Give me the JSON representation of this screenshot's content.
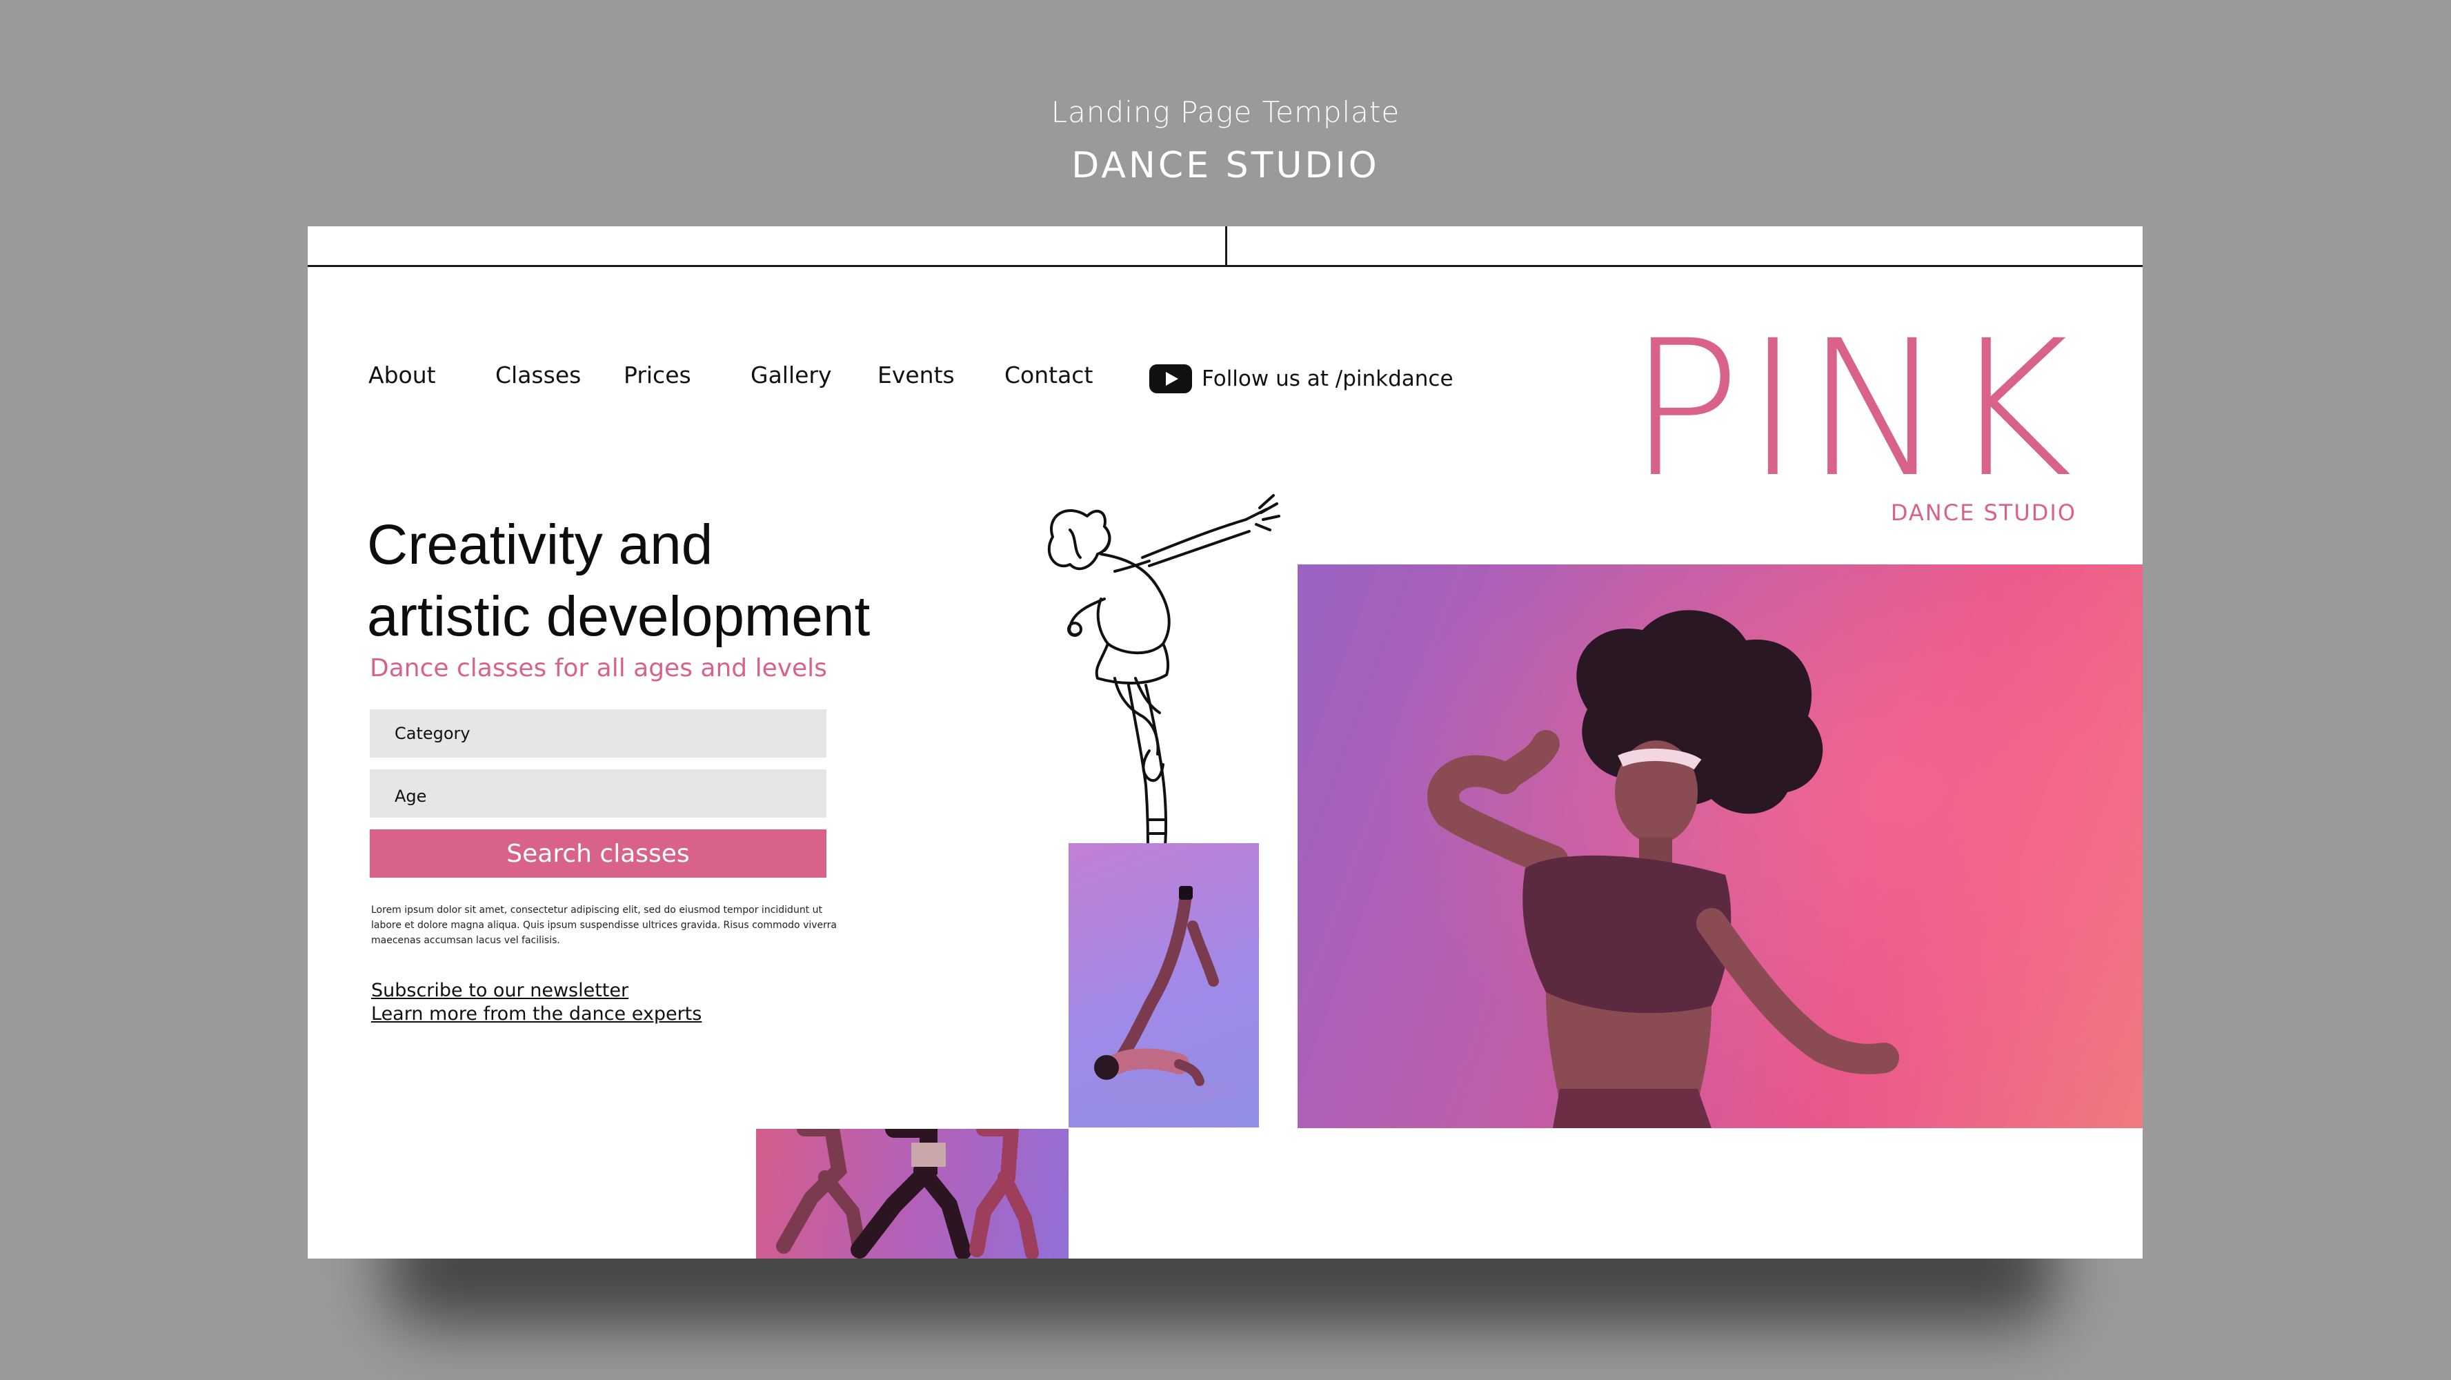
{
  "presentation": {
    "title": "Landing Page Template",
    "subtitle": "DANCE STUDIO"
  },
  "nav": {
    "items": [
      "About",
      "Classes",
      "Prices",
      "Gallery",
      "Events",
      "Contact"
    ],
    "follow_text": "Follow us at /pinkdance"
  },
  "logo": {
    "word": "PINK",
    "sub": "DANCE STUDIO"
  },
  "hero": {
    "headline_line1": "Creativity and",
    "headline_line2": "artistic development",
    "tagline": "Dance classes for all ages and levels"
  },
  "form": {
    "category_placeholder": "Category",
    "age_placeholder": "Age",
    "search_label": "Search classes"
  },
  "body_text": {
    "lorem": "Lorem ipsum dolor sit amet, consectetur adipiscing elit, sed do eiusmod tempor incididunt ut labore et dolore magna aliqua. Quis ipsum suspendisse ultrices gravida. Risus commodo viverra maecenas accumsan lacus vel facilisis."
  },
  "links": {
    "newsletter": "Subscribe to our newsletter",
    "experts": "Learn more from the dance experts"
  },
  "icons": {
    "social": "youtube-icon"
  },
  "colors": {
    "accent": "#d9628a",
    "background": "#9a9a9a",
    "field": "#e6e6e6"
  }
}
